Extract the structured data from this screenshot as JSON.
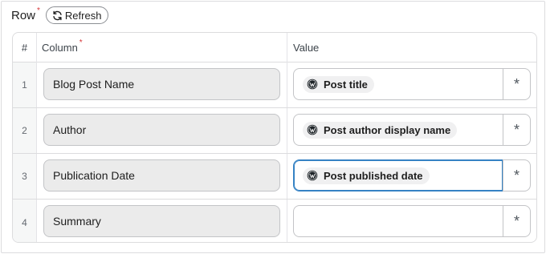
{
  "header": {
    "title": "Row",
    "required_mark": "*",
    "refresh_label": "Refresh"
  },
  "table": {
    "columns": {
      "num": "#",
      "column": "Column",
      "column_required": "*",
      "value": "Value"
    },
    "rows": [
      {
        "num": "1",
        "column": "Blog Post Name",
        "tag": "Post title",
        "tag_icon": "wordpress-icon",
        "action": "*"
      },
      {
        "num": "2",
        "column": "Author",
        "tag": "Post author display name",
        "tag_icon": "wordpress-icon",
        "action": "*"
      },
      {
        "num": "3",
        "column": "Publication Date",
        "tag": "Post published date",
        "tag_icon": "wordpress-icon",
        "action": "*",
        "focused": true
      },
      {
        "num": "4",
        "column": "Summary",
        "tag": "",
        "action": "*"
      }
    ]
  },
  "colors": {
    "required": "#d63638",
    "focus": "#3582c4",
    "input_bg": "#ebebeb",
    "tag_bg": "#f0f0f1"
  }
}
